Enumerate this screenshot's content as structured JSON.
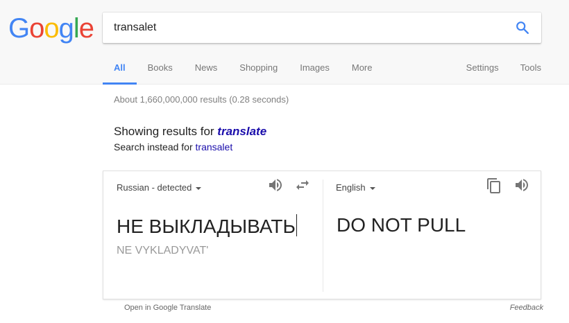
{
  "logo": {
    "text": "Google"
  },
  "search": {
    "query": "transalet"
  },
  "tabs": {
    "all": "All",
    "books": "Books",
    "news": "News",
    "shopping": "Shopping",
    "images": "Images",
    "more": "More",
    "settings": "Settings",
    "tools": "Tools"
  },
  "result_stats": "About 1,660,000,000 results (0.28 seconds)",
  "spelling": {
    "showing_prefix": "Showing results for ",
    "corrected": "translate",
    "instead_prefix": "Search instead for ",
    "original": "transalet"
  },
  "translate": {
    "source_lang": "Russian - detected",
    "target_lang": "English",
    "source_text": "НЕ ВЫКЛАДЫВАТЬ",
    "transliteration": "NE VYKLADYVAT'",
    "target_text": "DO NOT PULL",
    "open_link": "Open in Google Translate",
    "feedback": "Feedback"
  },
  "colors": {
    "accent": "#4285f4",
    "link": "#1a0dab",
    "logo_blue": "#4285f4",
    "logo_red": "#ea4335",
    "logo_yellow": "#fbbc05",
    "logo_green": "#34a853"
  }
}
